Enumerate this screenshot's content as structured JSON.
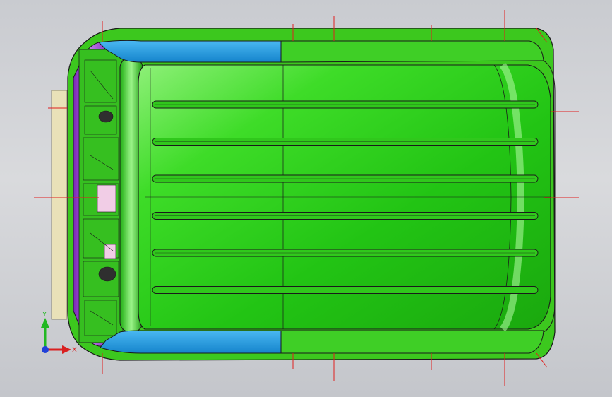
{
  "viewport": {
    "background_top": "#c9cbd0",
    "background_bottom": "#c4c6cb"
  },
  "model": {
    "roof_color": "#2fd61e",
    "rail_color": "#1e9de6",
    "header_color": "#9b3fd2",
    "frame_color": "#41c41f",
    "pad_color": "#e9e1b8",
    "reference_line_color": "#e02020",
    "roof_bow_count": 6
  },
  "triad": {
    "x_label": "X",
    "y_label": "Y",
    "x_color": "#d92020",
    "y_color": "#22b822",
    "z_color": "#2040d8"
  }
}
